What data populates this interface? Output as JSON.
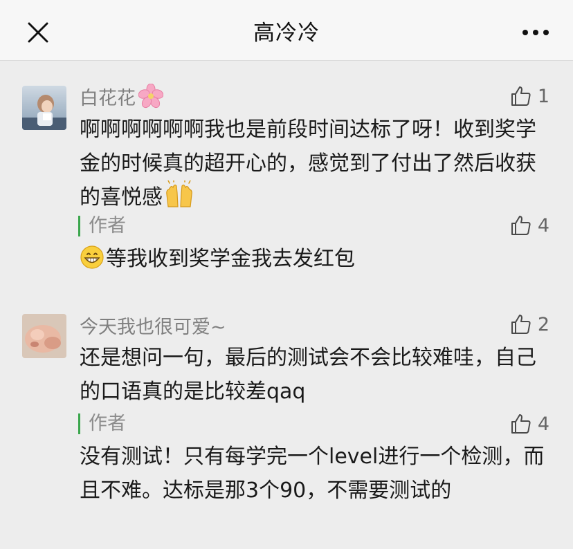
{
  "header": {
    "title": "高冷冷"
  },
  "icons": {
    "close": "close-icon",
    "more": "more-dots-icon",
    "like": "thumbs-up-icon",
    "flower": "cherry-blossom-emoji",
    "raise_hands": "raising-hands-emoji",
    "grin": "grinning-face-emoji"
  },
  "colors": {
    "author_bar": "#3aa64c",
    "page_bg": "#ededed",
    "header_bg": "#f7f7f7"
  },
  "comments": [
    {
      "nickname": "白花花",
      "likes": "1",
      "text": "啊啊啊啊啊啊我也是前段时间达标了呀！收到奖学金的时候真的超开心的，感觉到了付出了然后收获的喜悦感",
      "reply": {
        "label": "作者",
        "likes": "4",
        "text": "等我收到奖学金我去发红包"
      }
    },
    {
      "nickname": "今天我也很可爱~",
      "likes": "2",
      "text": "还是想问一句，最后的测试会不会比较难哇，自己的口语真的是比较差qaq",
      "reply": {
        "label": "作者",
        "likes": "4",
        "text": "没有测试！只有每学完一个level进行一个检测，而且不难。达标是那3个90，不需要测试的"
      }
    }
  ]
}
